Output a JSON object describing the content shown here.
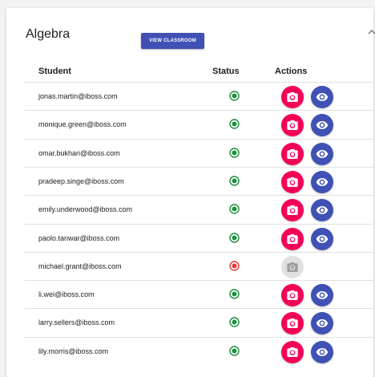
{
  "panel": {
    "title": "Algebra",
    "view_button_label": "VIEW CLASSROOM"
  },
  "table": {
    "headers": {
      "student": "Student",
      "status": "Status",
      "actions": "Actions"
    },
    "rows": [
      {
        "email": "jonas.martin@iboss.com",
        "status": "online",
        "actions_enabled": true
      },
      {
        "email": "monique.green@iboss.com",
        "status": "online",
        "actions_enabled": true
      },
      {
        "email": "omar.bukhari@iboss.com",
        "status": "online",
        "actions_enabled": true
      },
      {
        "email": "pradeep.singe@iboss.com",
        "status": "online",
        "actions_enabled": true
      },
      {
        "email": "emily.underwood@iboss.com",
        "status": "online",
        "actions_enabled": true
      },
      {
        "email": "paolo.tanwar@iboss.com",
        "status": "online",
        "actions_enabled": true
      },
      {
        "email": "michael.grant@iboss.com",
        "status": "offline",
        "actions_enabled": false
      },
      {
        "email": "li.wei@iboss.com",
        "status": "online",
        "actions_enabled": true
      },
      {
        "email": "larry.sellers@iboss.com",
        "status": "online",
        "actions_enabled": true
      },
      {
        "email": "lily.morris@iboss.com",
        "status": "online",
        "actions_enabled": true
      }
    ]
  },
  "icons": {
    "collapse": "chevron-up-icon",
    "status": "radio-dot-icon",
    "screenshot": "camera-icon",
    "view": "eye-icon"
  },
  "colors": {
    "online": "#1e8e3e",
    "offline": "#e53935",
    "camera_active": "#f50057",
    "camera_disabled": "#e0e0e0",
    "view_button": "#3f51b5",
    "eye_button": "#3f51b5"
  }
}
